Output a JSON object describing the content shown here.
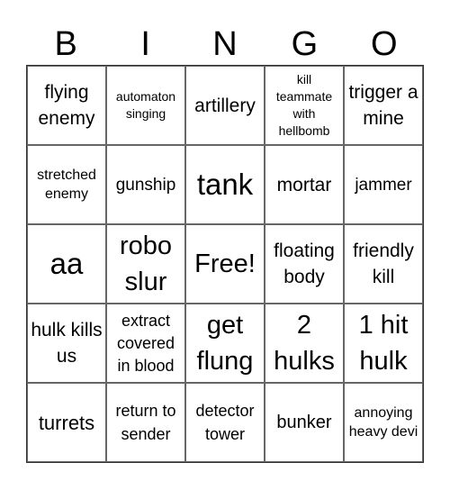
{
  "header": {
    "letters": [
      "B",
      "I",
      "N",
      "G",
      "O"
    ]
  },
  "cells": [
    [
      "flying enemy",
      "automaton singing",
      "artillery",
      "kill teammate with hellbomb",
      "trigger a mine"
    ],
    [
      "stretched enemy",
      "gunship",
      "tank",
      "mortar",
      "jammer"
    ],
    [
      "aa",
      "robo slur",
      "Free!",
      "floating body",
      "friendly kill"
    ],
    [
      "hulk kills us",
      "extract covered in blood",
      "get flung",
      "2 hulks",
      "1 hit hulk"
    ],
    [
      "turrets",
      "return to sender",
      "detector tower",
      "bunker",
      "annoying heavy devi"
    ]
  ]
}
